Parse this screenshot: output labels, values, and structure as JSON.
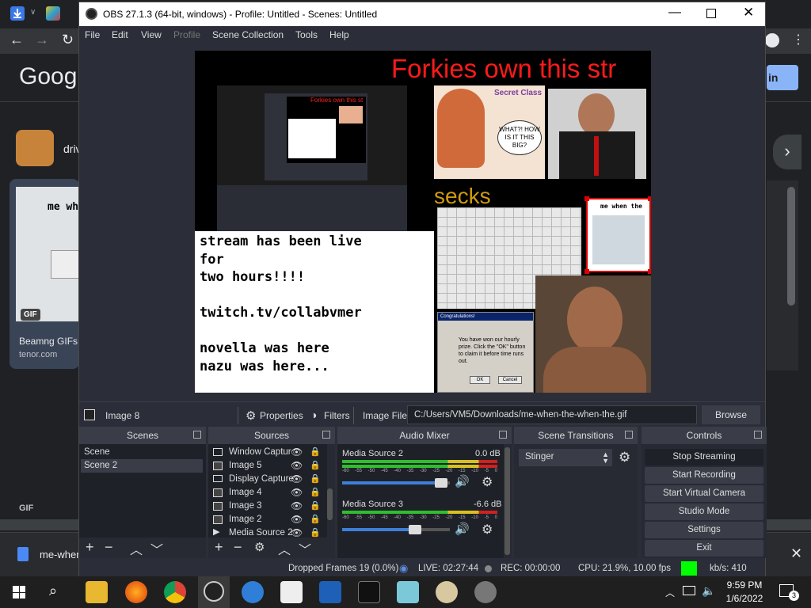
{
  "chrome": {
    "google_logo": "Googl",
    "sign_in": "in",
    "result_text": "driv",
    "card_title": "Beamng GIFs",
    "card_domain": "tenor.com",
    "gif_badge": "GIF",
    "gif_badge2": "GIF",
    "me_when": "me wh",
    "download_name": "me-when"
  },
  "obs": {
    "title": "OBS 27.1.3 (64-bit, windows) - Profile: Untitled - Scenes: Untitled",
    "menu": [
      "File",
      "Edit",
      "View",
      "Profile",
      "Scene Collection",
      "Tools",
      "Help"
    ],
    "preview": {
      "headline": "Forkies own this str",
      "secks": "secks",
      "comic_text": "WHAT?! HOW IS IT THIS BIG?",
      "comic_tag": "Secret Class",
      "me_when_the": "me when the",
      "text_lines": [
        "stream has been live",
        "for",
        "two hours!!!!",
        "",
        "twitch.tv/collabvmer",
        "",
        "novella was here",
        "nazu was here..."
      ],
      "popup_title": "Congratulations!",
      "popup_body": "You have won our hourly prize. Click the \"OK\" button to claim it before time runs out.",
      "popup_ok": "OK",
      "popup_cancel": "Cancel",
      "inner_headline": "Forkies own this st"
    },
    "source_toolbar": {
      "selected_name": "Image 8",
      "properties": "Properties",
      "filters": "Filters",
      "image_file_label": "Image File",
      "path": "C:/Users/VM5/Downloads/me-when-the-when-the.gif",
      "browse": "Browse"
    },
    "scenes": {
      "title": "Scenes",
      "items": [
        "Scene",
        "Scene 2"
      ]
    },
    "sources": {
      "title": "Sources",
      "items": [
        "Window Captur",
        "Image 5",
        "Display Capture",
        "Image 4",
        "Image 3",
        "Image 2",
        "Media Source 2"
      ]
    },
    "audio_mixer": {
      "title": "Audio Mixer",
      "channels": [
        {
          "name": "Media Source 2",
          "db": "0.0 dB",
          "volume": 0.92
        },
        {
          "name": "Media Source 3",
          "db": "-6.6 dB",
          "volume": 0.68
        }
      ],
      "scale": [
        "-60",
        "-55",
        "-50",
        "-45",
        "-40",
        "-35",
        "-30",
        "-25",
        "-20",
        "-15",
        "-10",
        "-5",
        "0"
      ]
    },
    "transitions": {
      "title": "Scene Transitions",
      "selected": "Stinger"
    },
    "controls": {
      "title": "Controls",
      "buttons": [
        "Stop Streaming",
        "Start Recording",
        "Start Virtual Camera",
        "Studio Mode",
        "Settings",
        "Exit"
      ]
    },
    "status": {
      "dropped": "Dropped Frames 19 (0.0%)",
      "live": "LIVE: 02:27:44",
      "rec": "REC: 00:00:00",
      "cpu": "CPU: 21.9%, 10.00 fps",
      "kbs": "kb/s: 410",
      "indicator_color": "#00ff00"
    }
  },
  "taskbar": {
    "time": "9:59 PM",
    "date": "1/6/2022",
    "notif_count": "3"
  }
}
